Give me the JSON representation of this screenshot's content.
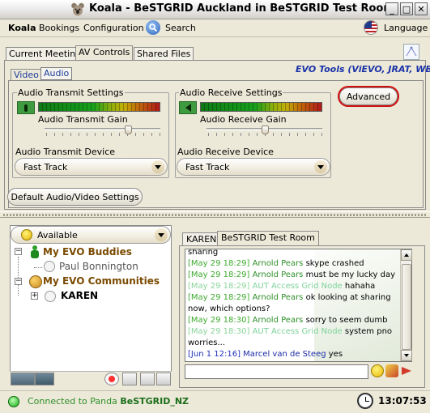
{
  "window": {
    "title": "Koala - BeSTGRID Auckland in BeSTGRID Test Room",
    "minimize": "_",
    "maximize": "□",
    "close": "✕"
  },
  "menu": {
    "items": [
      "Koala",
      "Bookings",
      "Configuration",
      "Search",
      "Language"
    ]
  },
  "main_tabs": [
    "Current Meeting",
    "AV Controls",
    "Shared Files"
  ],
  "sub_tabs": [
    "Video",
    "Audio"
  ],
  "evo_tools": "EVO Tools (ViEVO, JRAT, WB)",
  "audio_transmit": {
    "title": "Audio Transmit Settings",
    "gain_label": "Audio Transmit Gain",
    "gain_level": 0.72,
    "device_label": "Audio Transmit Device",
    "device_value": "Fast Track"
  },
  "audio_receive": {
    "title": "Audio Receive Settings",
    "gain_label": "Audio Receive Gain",
    "gain_level": 0.5,
    "device_label": "Audio Receive Device",
    "device_value": "Fast Track"
  },
  "buttons": {
    "advanced": "Advanced",
    "default_av": "Default Audio/Video Settings"
  },
  "presence": {
    "status": "Available"
  },
  "tree": {
    "buddies_label": "My EVO Buddies",
    "buddy_1": "Paul Bonnington",
    "communities_label": "My EVO Communities",
    "community_1": "KAREN",
    "expand": "+",
    "collapse": "−"
  },
  "chat_tabs": [
    "KAREN",
    "BeSTGRID Test Room"
  ],
  "chat": [
    {
      "time": "",
      "name": "",
      "text": "sharing"
    },
    {
      "time": "[May 29 18:29]",
      "name": "Arnold Pears",
      "text": "skype crashed"
    },
    {
      "time": "[May 29 18:29]",
      "name": "Arnold Pears",
      "text": "must be my lucky day"
    },
    {
      "time": "[May 29 18:29]",
      "name": "AUT Access Grid Node",
      "text": "hahaha"
    },
    {
      "time": "[May 29 18:29]",
      "name": "Arnold Pears",
      "text": "ok looking at sharing"
    },
    {
      "time": "",
      "name": "",
      "text": "now, which options?"
    },
    {
      "time": "[May 29 18:30]",
      "name": "Arnold Pears",
      "text": "sorry to seem dumb"
    },
    {
      "time": "[May 29 18:30]",
      "name": "AUT Access Grid Node",
      "text": "system pno"
    },
    {
      "time": "",
      "name": "",
      "text": "worries..."
    },
    {
      "time": "[Jun 1 12:16]",
      "name": "Marcel van de Steeg",
      "text": "yes"
    }
  ],
  "status": {
    "connected_prefix": "Connected to Panda ",
    "connected_target": "BeSTGRID_NZ",
    "clock": "13:07:53"
  }
}
